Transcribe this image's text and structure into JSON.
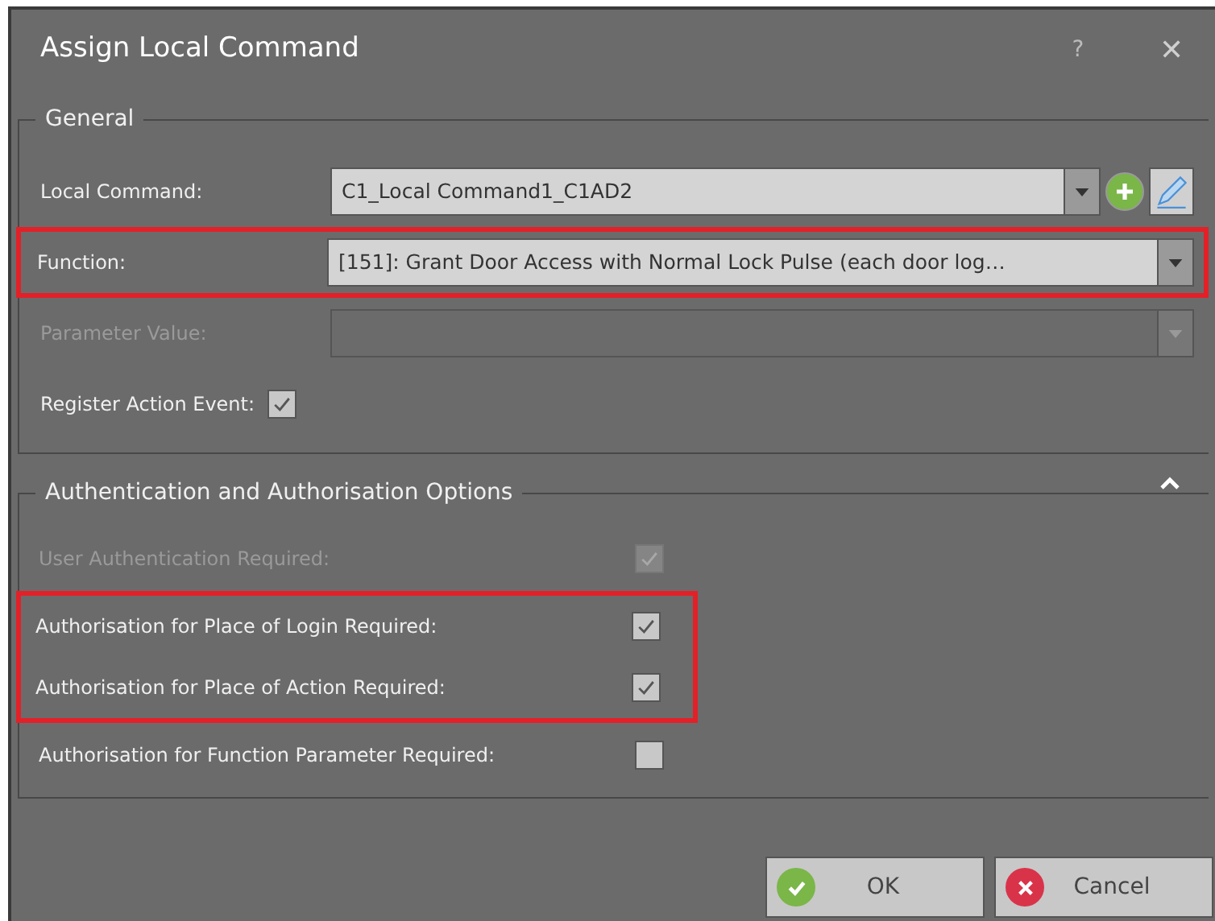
{
  "window": {
    "title": "Assign Local Command",
    "help": "?",
    "close": "✕"
  },
  "general": {
    "title": "General",
    "rows": [
      {
        "kind": "combo",
        "label": "Local Command:",
        "value": "C1_Local Command1_C1AD2",
        "disabled": false,
        "highlighted": false,
        "has_actions": true
      },
      {
        "kind": "combo",
        "label": "Function:",
        "value": "[151]: Grant Door Access with Normal Lock Pulse (each door log…",
        "disabled": false,
        "highlighted": true,
        "has_actions": false
      },
      {
        "kind": "combo",
        "label": "Parameter Value:",
        "disabled": true,
        "highlighted": false,
        "has_actions": false
      },
      {
        "kind": "checkbox",
        "label": "Register Action Event:",
        "checked": true,
        "disabled": false,
        "highlighted": false
      }
    ]
  },
  "auth": {
    "title": "Authentication and Authorisation Options",
    "expanded": true,
    "rows": [
      {
        "label": "User Authentication Required:",
        "checked": true,
        "disabled": true,
        "highlighted": false
      },
      {
        "label": "Authorisation for Place of Login Required:",
        "checked": true,
        "disabled": false,
        "highlighted": true
      },
      {
        "label": "Authorisation for Place of Action Required:",
        "checked": true,
        "disabled": false,
        "highlighted": true
      },
      {
        "label": "Authorisation for Function Parameter Required:",
        "checked": false,
        "disabled": false,
        "highlighted": false
      }
    ]
  },
  "buttons": [
    {
      "kind": "ok",
      "label": "OK"
    },
    {
      "kind": "cancel",
      "label": "Cancel"
    }
  ]
}
